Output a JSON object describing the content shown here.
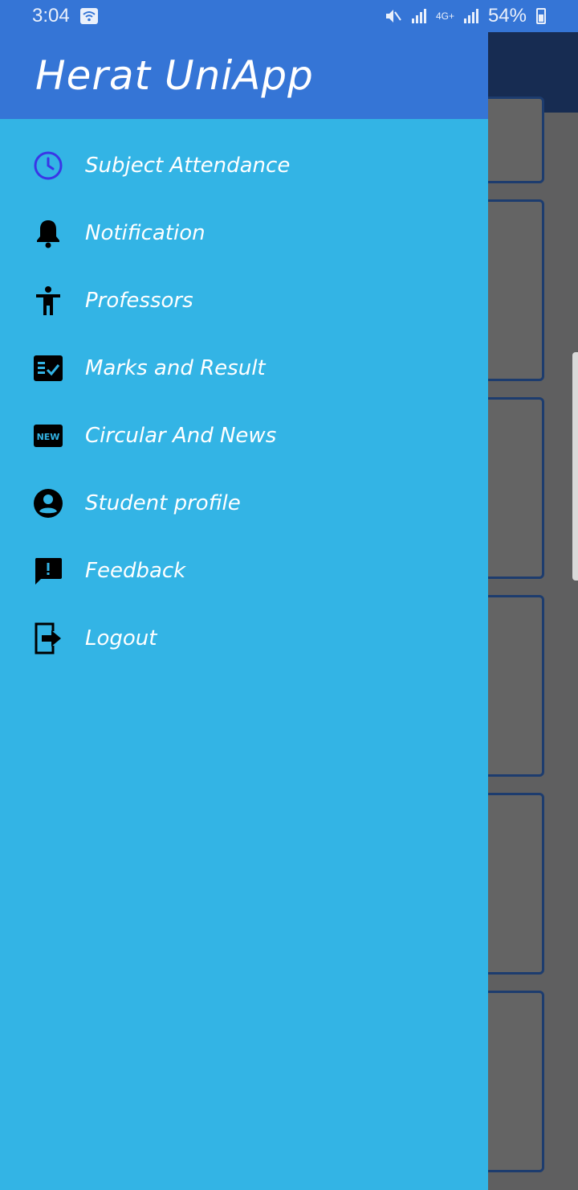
{
  "status": {
    "time": "3:04",
    "battery_percent": "54%",
    "network": "4G+"
  },
  "app": {
    "title": "Herat UniApp"
  },
  "menu": {
    "items": [
      {
        "label": "Subject Attendance",
        "icon": "clock-icon",
        "color": "#3a36e6"
      },
      {
        "label": "Notification",
        "icon": "bell-icon",
        "color": "#000000"
      },
      {
        "label": "Professors",
        "icon": "accessibility-icon",
        "color": "#000000"
      },
      {
        "label": "Marks and Result",
        "icon": "checklist-icon",
        "color": "#000000"
      },
      {
        "label": "Circular And News",
        "icon": "new-badge-icon",
        "color": "#000000"
      },
      {
        "label": "Student profile",
        "icon": "account-circle-icon",
        "color": "#000000"
      },
      {
        "label": "Feedback",
        "icon": "feedback-icon",
        "color": "#000000"
      },
      {
        "label": "Logout",
        "icon": "logout-icon",
        "color": "#000000"
      }
    ]
  },
  "new_badge_text": "NEW",
  "colors": {
    "status_bar": "#3575d6",
    "drawer": "#33b4e5",
    "header": "#3575d6",
    "ring_green": "#0b6b0b",
    "ring_red": "#6b0b0b"
  }
}
